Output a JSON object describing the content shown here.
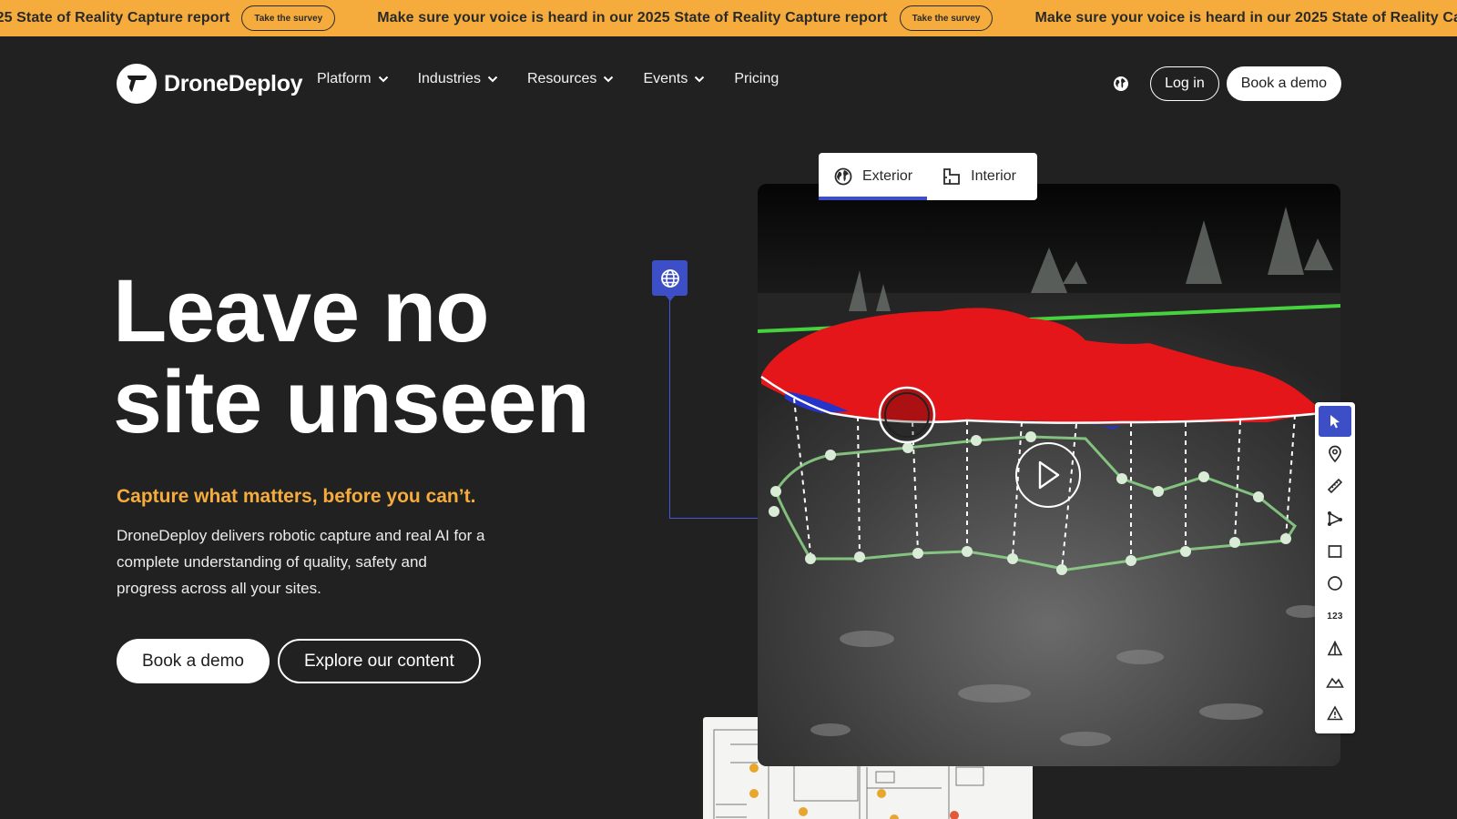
{
  "announcement": {
    "text": "Make sure your voice is heard in our 2025 State of Reality Capture report",
    "button": "Take the survey"
  },
  "brand": {
    "name": "DroneDeploy"
  },
  "nav": {
    "items": [
      {
        "label": "Platform",
        "dropdown": true
      },
      {
        "label": "Industries",
        "dropdown": true
      },
      {
        "label": "Resources",
        "dropdown": true
      },
      {
        "label": "Events",
        "dropdown": true
      },
      {
        "label": "Pricing",
        "dropdown": false
      }
    ],
    "language_icon": "globe-icon",
    "login": "Log in",
    "book_demo": "Book a demo"
  },
  "hero": {
    "title_line1": "Leave no",
    "title_line2": "site unseen",
    "subtitle": "Capture what matters, before you can’t.",
    "description": "DroneDeploy delivers robotic capture and real AI for a complete understanding of quality, safety and progress across all your sites.",
    "cta_primary": "Book a demo",
    "cta_secondary": "Explore our content"
  },
  "viewer": {
    "tabs": [
      {
        "label": "Exterior",
        "icon": "globe-icon",
        "active": true
      },
      {
        "label": "Interior",
        "icon": "floorplan-icon",
        "active": false
      }
    ],
    "tools": [
      "cursor-icon",
      "location-pin-icon",
      "ruler-icon",
      "polyline-icon",
      "rectangle-icon",
      "circle-icon",
      "count-icon",
      "volume-icon",
      "elevation-icon",
      "hazard-icon"
    ],
    "count_label": "123",
    "play_icon": "play-icon"
  },
  "colors": {
    "announcement_bg": "#f6ac3c",
    "page_bg": "#212121",
    "accent": "#f6ac3c",
    "brand_blue": "#3d4fc7"
  }
}
